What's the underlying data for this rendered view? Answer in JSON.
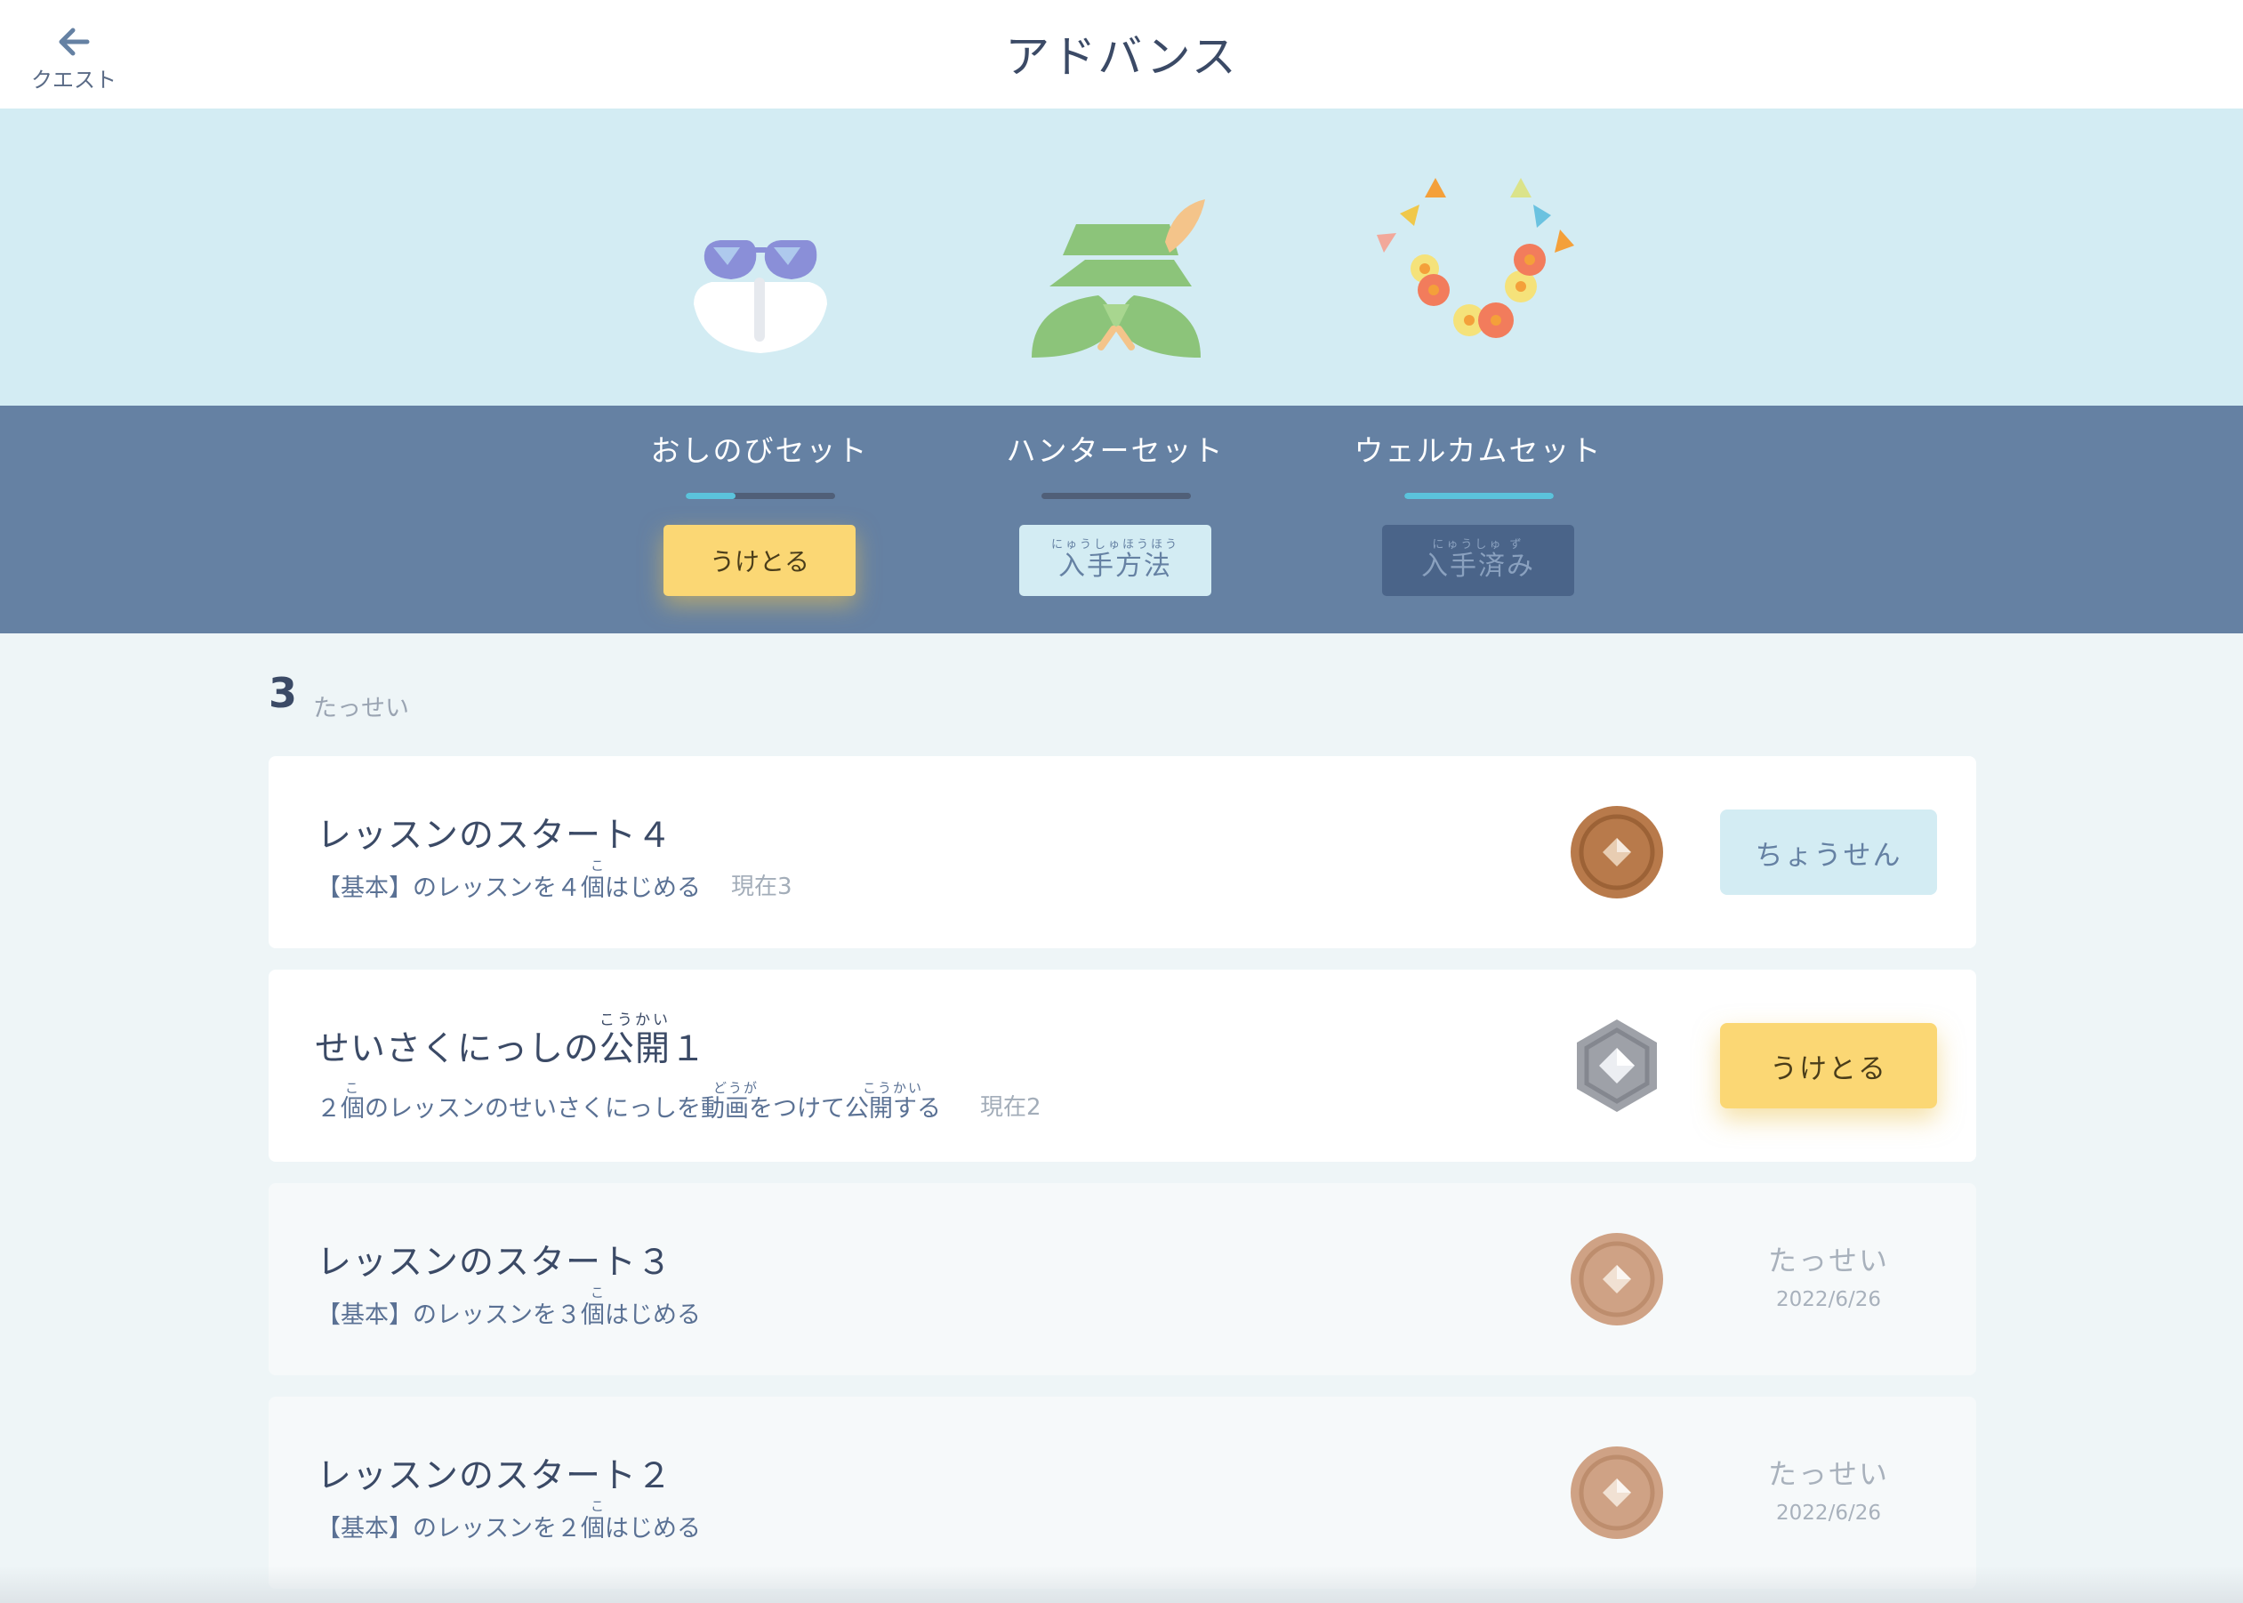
{
  "header": {
    "back_label": "クエスト",
    "title": "アドバンス"
  },
  "rewards": [
    {
      "name": "おしのびセット",
      "progress": 0.33,
      "button_label": "うけとる",
      "button_ruby": "",
      "button_style": "yellow",
      "icon": "sunglasses-scarf-icon"
    },
    {
      "name": "ハンターセット",
      "progress": 0,
      "button_label": "入手方法",
      "button_ruby": "にゅうしゅほうほう",
      "button_style": "light",
      "icon": "hunter-hat-icon"
    },
    {
      "name": "ウェルカムセット",
      "progress": 1,
      "button_label": "入手済み",
      "button_ruby": "にゅうしゅ ず",
      "button_style": "dark",
      "icon": "flower-lei-icon"
    }
  ],
  "achievements": {
    "count": "3",
    "count_label": "たっせい"
  },
  "quests": [
    {
      "title": "レッスンのスタート４",
      "description": "【基本】のレッスンを４個はじめる",
      "furigana": "こ",
      "current": "現在3",
      "medal": "bronze",
      "action": "ちょうせん",
      "state": "challenge"
    },
    {
      "title": "せいさくにっしの公開１",
      "title_furigana": "こうかい",
      "description": "２個のレッスンのせいさくにっしを動画をつけて公開する",
      "furigana_1": "こ",
      "furigana_2": "どうが",
      "furigana_3": "こうかい",
      "current": "現在2",
      "medal": "silver",
      "action": "うけとる",
      "state": "receive"
    },
    {
      "title": "レッスンのスタート３",
      "description": "【基本】のレッスンを３個はじめる",
      "furigana": "こ",
      "medal": "bronze",
      "status": "たっせい",
      "date": "2022/6/26",
      "state": "done"
    },
    {
      "title": "レッスンのスタート２",
      "description": "【基本】のレッスンを２個はじめる",
      "furigana": "こ",
      "medal": "bronze",
      "status": "たっせい",
      "date": "2022/6/26",
      "state": "done"
    }
  ],
  "colors": {
    "header_bg": "#ffffff",
    "banner_bg": "#d3ecf3",
    "sets_bg": "#6581a3",
    "accent_yellow": "#fbd774",
    "progress_fill": "#5bc3dc"
  }
}
